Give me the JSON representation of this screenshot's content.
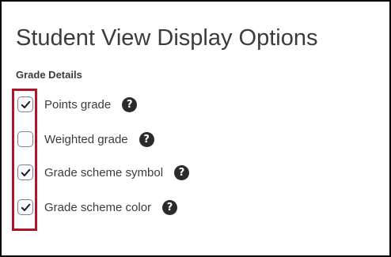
{
  "page": {
    "title": "Student View Display Options",
    "section_label": "Grade Details"
  },
  "options": [
    {
      "label": "Points grade",
      "checked": true,
      "help_icon": "question-circle-icon"
    },
    {
      "label": "Weighted grade",
      "checked": false,
      "help_icon": "question-circle-icon"
    },
    {
      "label": "Grade scheme symbol",
      "checked": true,
      "help_icon": "question-circle-icon"
    },
    {
      "label": "Grade scheme color",
      "checked": true,
      "help_icon": "question-circle-icon"
    }
  ],
  "icons": {
    "check": "checkmark-icon",
    "help": "question-circle-icon",
    "help_glyph": "?"
  },
  "colors": {
    "highlight": "#b0142b",
    "text": "#3b3b3b",
    "help_icon_bg": "#2b2b2b",
    "checkbox_border": "#7b8196"
  }
}
